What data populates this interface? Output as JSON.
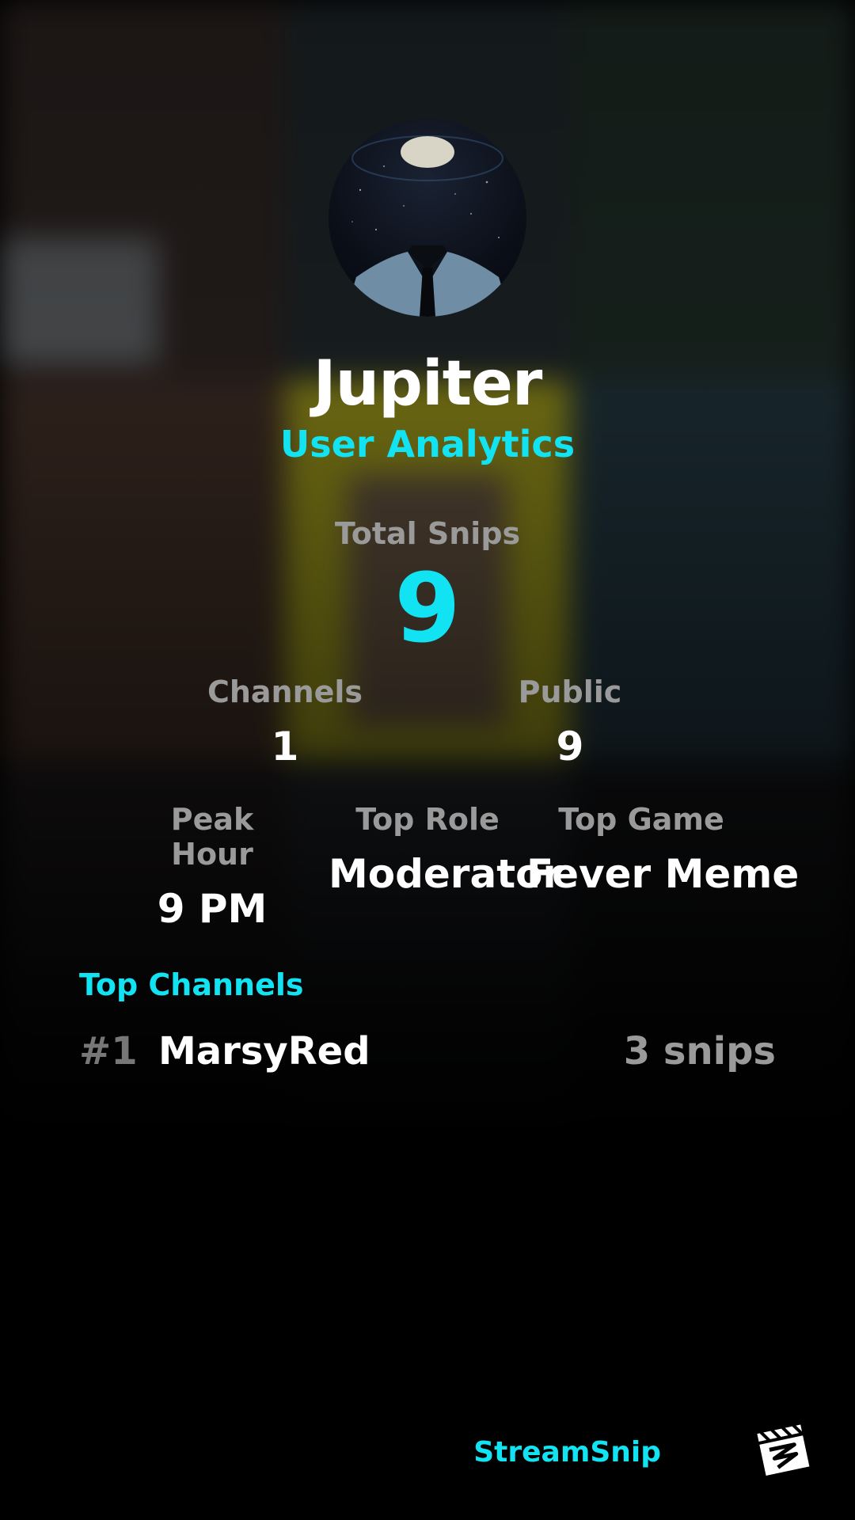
{
  "profile": {
    "name": "Jupiter",
    "subtitle": "User Analytics"
  },
  "totals": {
    "total_snips_label": "Total Snips",
    "total_snips_value": "9"
  },
  "stats_row1": [
    {
      "label": "Channels",
      "value": "1"
    },
    {
      "label": "Public",
      "value": "9"
    }
  ],
  "stats_row2": [
    {
      "label": "Peak Hour",
      "value": "9 PM"
    },
    {
      "label": "Top Role",
      "value": "Moderator"
    },
    {
      "label": "Top Game",
      "value": "Fever Meme"
    }
  ],
  "top_channels": {
    "title": "Top Channels",
    "items": [
      {
        "rank": "#1",
        "name": "MarsyRed",
        "snips": "3 snips"
      }
    ]
  },
  "brand": {
    "name": "StreamSnip",
    "accent": "#12e3f2",
    "logo_icon": "clapperboard-icon"
  },
  "avatar_icon": "person-galaxy-avatar"
}
